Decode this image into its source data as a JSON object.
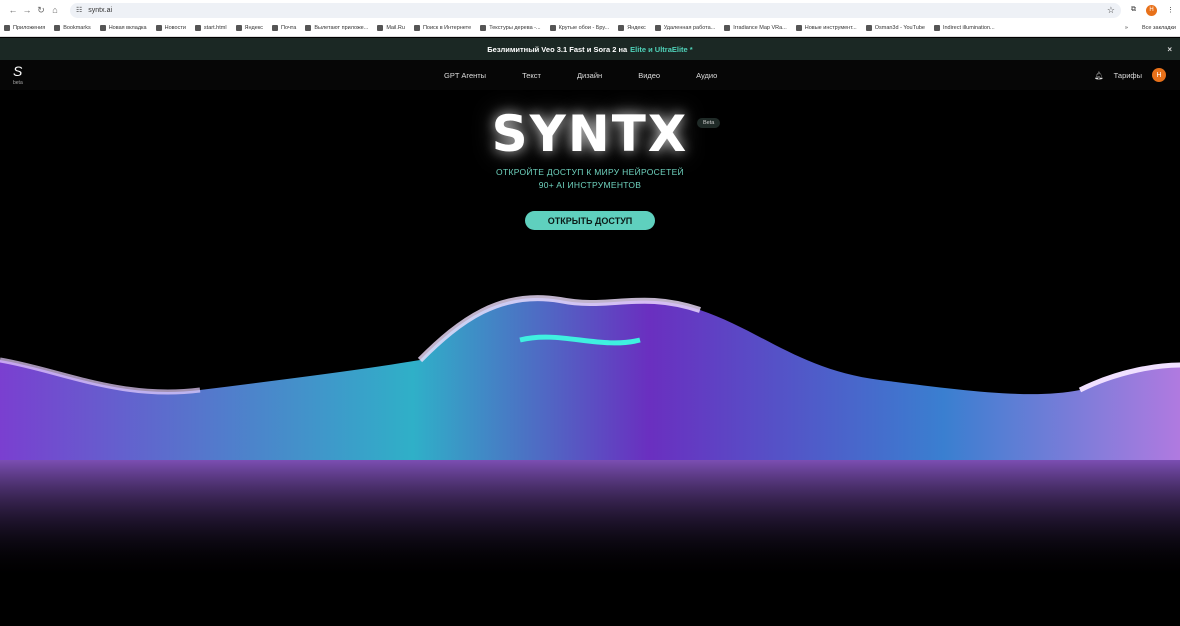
{
  "browser": {
    "url": "syntx.ai",
    "profile_initial": "Н"
  },
  "bookmarks": [
    "Приложения",
    "Bookmarks",
    "Новая вкладка",
    "Новости",
    "start.html",
    "Яндекс",
    "Почта",
    "Вылетают приложе...",
    "Mail.Ru",
    "Поиск в Интернете",
    "Текстуры дерева -...",
    "Крутые обои - Бру...",
    "Яндекс",
    "Удаленная работа...",
    "Irradiance Map VRa...",
    "Новые инструмент...",
    "Osman3d - YouTube",
    "Indirect illumination..."
  ],
  "bookmarks_more": "»",
  "bookmarks_all": "Все закладки",
  "banner": {
    "text": "Безлимитный Veo 3.1 Fast и Sora 2 на",
    "highlight": "Elite и UltraElite *",
    "close": "×"
  },
  "nav": {
    "logo": "S",
    "logo_sub": "beta",
    "items": [
      "GPT Агенты",
      "Текст",
      "Дизайн",
      "Видео",
      "Аудио"
    ],
    "pricing": "Тарифы",
    "avatar": "Н"
  },
  "hero": {
    "title": "SYNTX",
    "badge": "Beta",
    "subtitle1": "ОТКРОЙТЕ ДОСТУП К МИРУ НЕЙРОСЕТЕЙ",
    "subtitle2": "90+ AI ИНСТРУМЕНТОВ",
    "cta": "ОТКРЫТЬ ДОСТУП"
  }
}
